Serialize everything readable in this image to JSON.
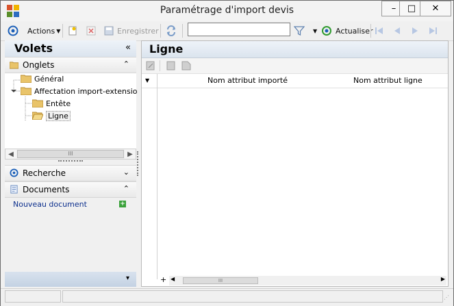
{
  "window": {
    "title": "Paramétrage d'import devis",
    "minimize_label": "–",
    "maximize_label": "□",
    "close_label": "✕"
  },
  "toolbar": {
    "actions_label": "Actions",
    "save_label": "Enregistrer",
    "search_value": "",
    "refresh_label": "Actualiser"
  },
  "left_panel": {
    "title": "Volets",
    "collapse_glyph": "«",
    "tabs_section": {
      "label": "Onglets",
      "chevron": "⌃"
    },
    "tree": [
      {
        "label": "Général"
      },
      {
        "label": "Affectation import-extensio"
      },
      {
        "label": "Entête"
      },
      {
        "label": "Ligne",
        "selected": true
      }
    ],
    "search_section": {
      "label": "Recherche",
      "chevron": "⌄"
    },
    "documents_section": {
      "label": "Documents",
      "chevron": "⌃",
      "new_document": "Nouveau document"
    },
    "bottom_chevron": "▾"
  },
  "right_panel": {
    "title": "Ligne",
    "columns": [
      "Nom attribut importé",
      "Nom attribut ligne"
    ],
    "add_row_glyph": "+"
  },
  "colors": {
    "panel_header_top": "#eef3f9",
    "panel_header_bottom": "#dbe4ee",
    "link": "#0b2e8c",
    "accent_blue": "#1b5fb8"
  }
}
